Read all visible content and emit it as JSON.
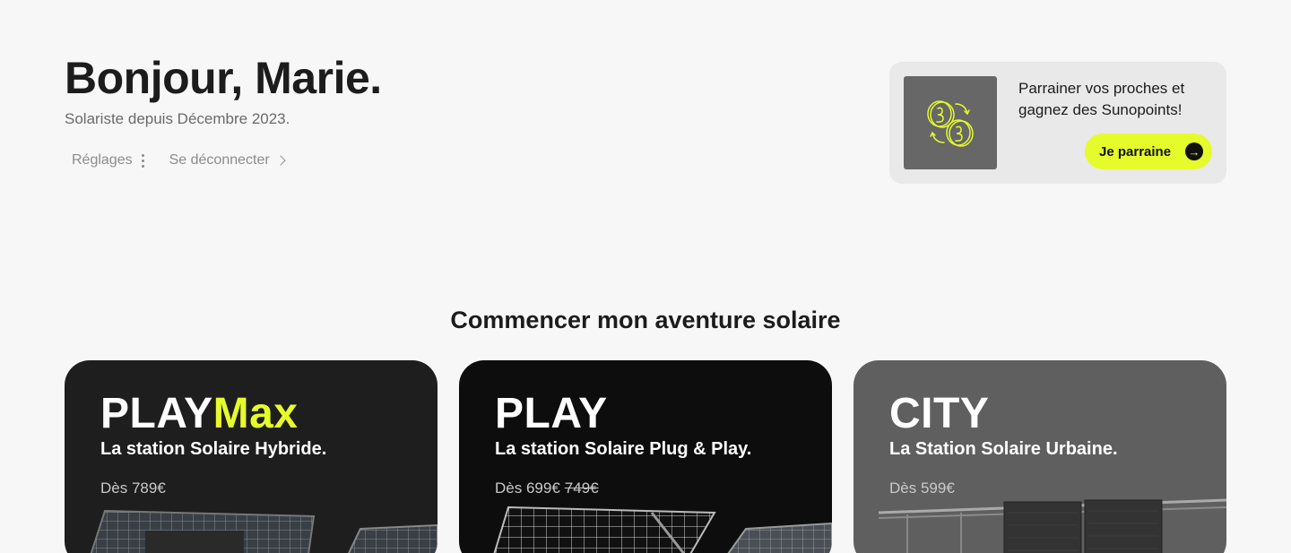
{
  "header": {
    "greeting": "Bonjour, Marie.",
    "subtitle": "Solariste depuis Décembre 2023.",
    "settings_label": "Réglages",
    "logout_label": "Se déconnecter"
  },
  "referral": {
    "text": "Parrainer vos proches et gagnez des Sunopoints!",
    "button_label": "Je parraine",
    "icon": "coins-exchange-icon",
    "accent_color": "#e5fb2b"
  },
  "section": {
    "title": "Commencer mon aventure solaire"
  },
  "products": [
    {
      "name_main": "PLAY",
      "name_accent": "Max",
      "tagline": "La station Solaire Hybride.",
      "price": "Dès 789€",
      "old_price": ""
    },
    {
      "name_main": "PLAY",
      "name_accent": "",
      "tagline": "La station Solaire Plug & Play.",
      "price": "Dès 699€",
      "old_price": "749€"
    },
    {
      "name_main": "CITY",
      "name_accent": "",
      "tagline": "La Station Solaire Urbaine.",
      "price": "Dès 599€",
      "old_price": ""
    }
  ]
}
